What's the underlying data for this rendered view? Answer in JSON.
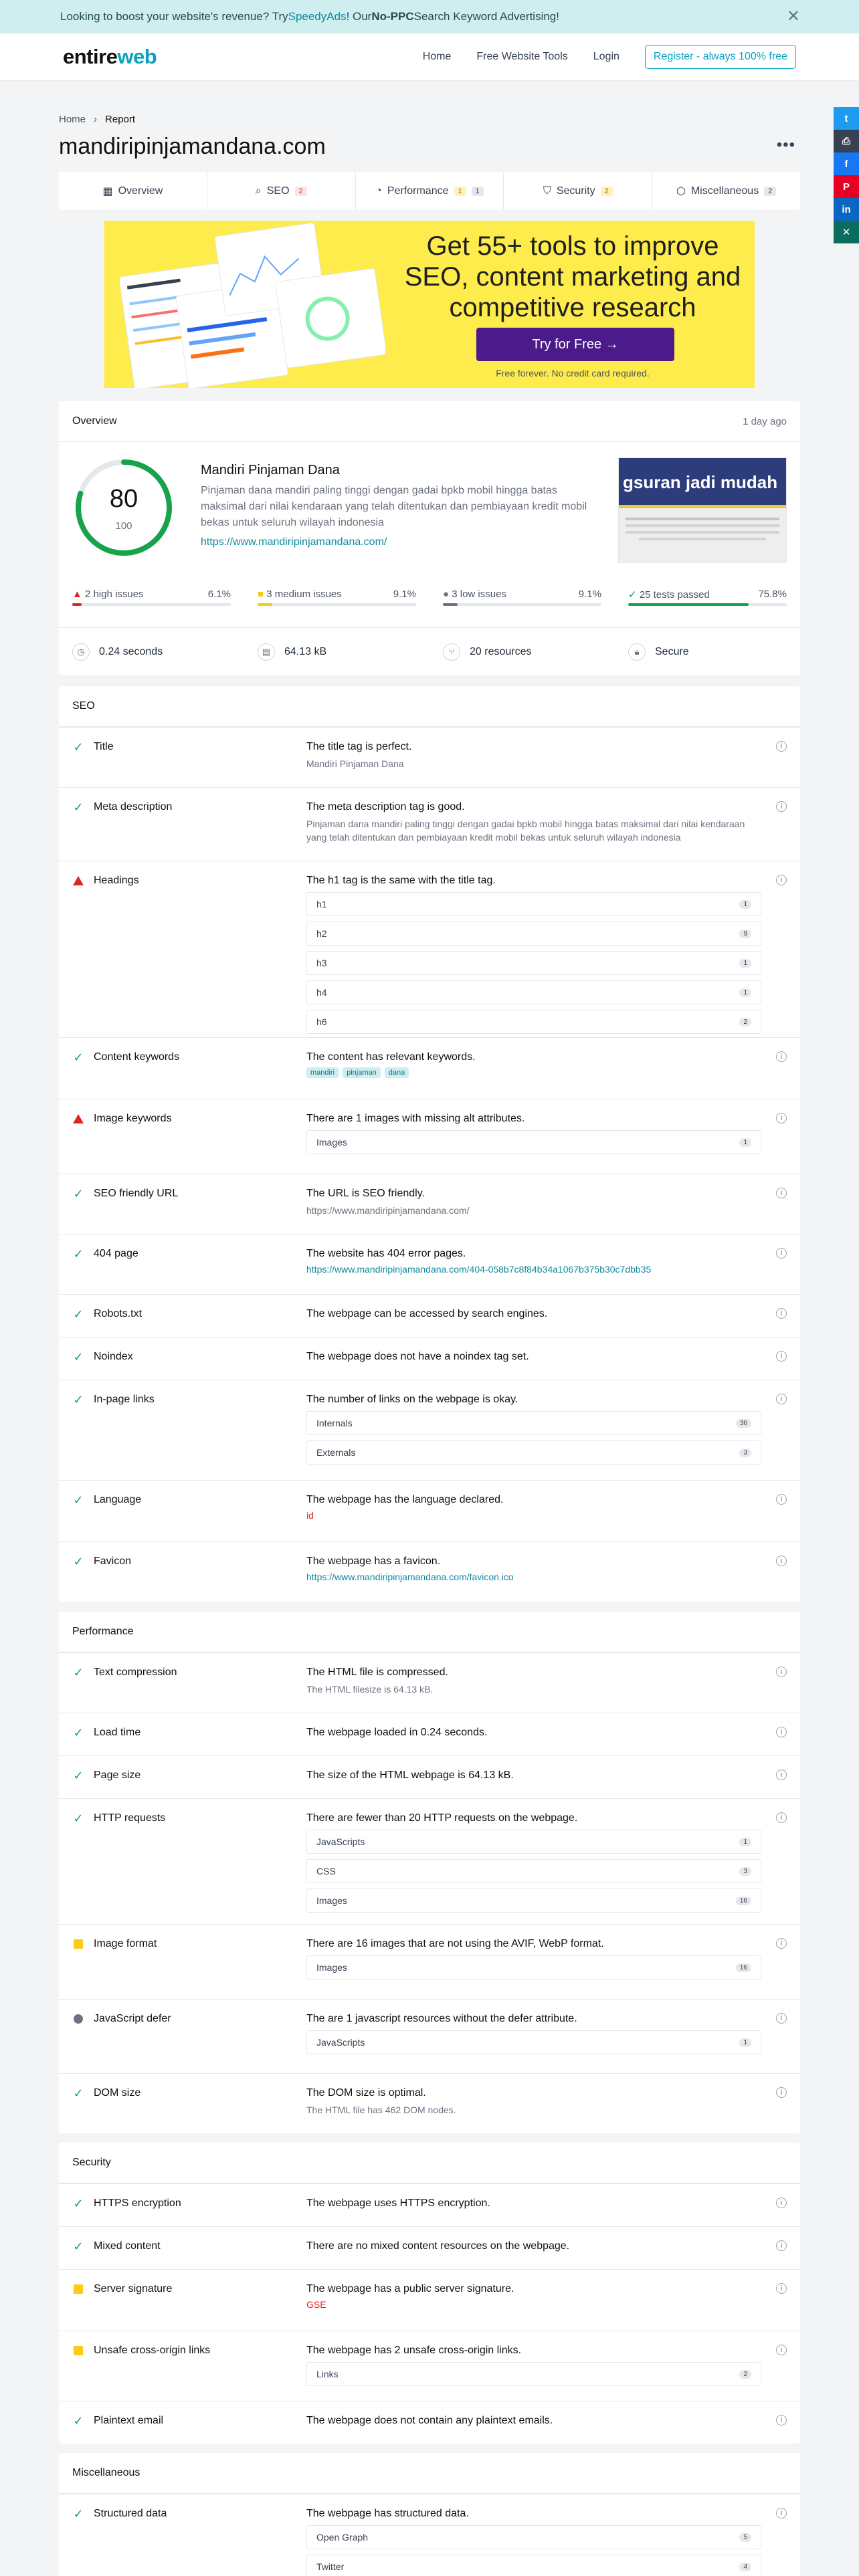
{
  "banner": {
    "pre": "Looking to boost your website's revenue? Try ",
    "brand": "SpeedyAds",
    "mid": "! Our ",
    "bold": "No-PPC",
    "post": " Search Keyword Advertising!"
  },
  "nav": {
    "logo_a": "entire",
    "logo_b": "web",
    "home": "Home",
    "tools": "Free Website Tools",
    "login": "Login",
    "register": "Register - always 100% free"
  },
  "breadcrumb": {
    "home": "Home",
    "current": "Report"
  },
  "domain": "mandiripinjamandana.com",
  "tabs": [
    {
      "label": "Overview"
    },
    {
      "label": "SEO",
      "badge": "2"
    },
    {
      "label": "Performance",
      "badge1": "1",
      "badge2": "1"
    },
    {
      "label": "Security",
      "badge": "2"
    },
    {
      "label": "Miscellaneous",
      "badge": "2"
    }
  ],
  "promo": {
    "headline": "Get 55+ tools to improve SEO, content marketing and competitive research",
    "button": "Try for Free →",
    "note": "Free forever. No credit card required."
  },
  "overview": {
    "title": "Overview",
    "time": "1 day ago",
    "score": "80",
    "score_max": "100",
    "site_name": "Mandiri Pinjaman Dana",
    "site_desc": "Pinjaman dana mandiri paling tinggi dengan gadai bpkb mobil hingga batas maksimal dari nilai kendaraan yang telah ditentukan dan pembiayaan kredit mobil bekas untuk seluruh wilayah indonesia",
    "site_url": "https://www.mandiripinjamandana.com/",
    "thumb_text": "gsuran jadi mudah",
    "stats": [
      {
        "label": "2 high issues",
        "pct": "6.1%",
        "fill": 6.1,
        "color": "#dc2626"
      },
      {
        "label": "3 medium issues",
        "pct": "9.1%",
        "fill": 9.1,
        "color": "#facc15"
      },
      {
        "label": "3 low issues",
        "pct": "9.1%",
        "fill": 9.1,
        "color": "#6b7280"
      },
      {
        "label": "25 tests passed",
        "pct": "75.8%",
        "fill": 75.8,
        "color": "#16a34a"
      }
    ],
    "info": [
      {
        "label": "0.24 seconds",
        "icon": "clock-icon"
      },
      {
        "label": "64.13 kB",
        "icon": "size-icon"
      },
      {
        "label": "20 resources",
        "icon": "resources-icon"
      },
      {
        "label": "Secure",
        "icon": "lock-icon"
      }
    ]
  },
  "seo": {
    "title": "SEO",
    "rows": {
      "title": {
        "name": "Title",
        "text": "The title tag is perfect.",
        "sub": "Mandiri Pinjaman Dana"
      },
      "meta": {
        "name": "Meta description",
        "text": "The meta description tag is good.",
        "sub": "Pinjaman dana mandiri paling tinggi dengan gadai bpkb mobil hingga batas maksimal dari nilai kendaraan yang telah ditentukan dan pembiayaan kredit mobil bekas untuk seluruh wilayah indonesia"
      },
      "headings": {
        "name": "Headings",
        "text": "The h1 tag is the same with the title tag.",
        "items": [
          {
            "k": "h1",
            "v": "1"
          },
          {
            "k": "h2",
            "v": "9"
          },
          {
            "k": "h3",
            "v": "1"
          },
          {
            "k": "h4",
            "v": "1"
          },
          {
            "k": "h6",
            "v": "2"
          }
        ]
      },
      "content": {
        "name": "Content keywords",
        "text": "The content has relevant keywords.",
        "kw": [
          "mandiri",
          "pinjaman",
          "dana"
        ]
      },
      "imgkw": {
        "name": "Image keywords",
        "text": "There are 1 images with missing alt attributes.",
        "box": "Images",
        "count": "1"
      },
      "url": {
        "name": "SEO friendly URL",
        "text": "The URL is SEO friendly.",
        "sub": "https://www.mandiripinjamandana.com/"
      },
      "p404": {
        "name": "404 page",
        "text": "The website has 404 error pages.",
        "link": "https://www.mandiripinjamandana.com/404-058b7c8f84b34a1067b375b30c7dbb35"
      },
      "robots": {
        "name": "Robots.txt",
        "text": "The webpage can be accessed by search engines."
      },
      "noindex": {
        "name": "Noindex",
        "text": "The webpage does not have a noindex tag set."
      },
      "inpage": {
        "name": "In-page links",
        "text": "The number of links on the webpage is okay.",
        "items": [
          {
            "k": "Internals",
            "v": "36"
          },
          {
            "k": "Externals",
            "v": "3"
          }
        ]
      },
      "lang": {
        "name": "Language",
        "text": "The webpage has the language declared.",
        "val": "id"
      },
      "favicon": {
        "name": "Favicon",
        "text": "The webpage has a favicon.",
        "link": "https://www.mandiripinjamandana.com/favicon.ico"
      }
    }
  },
  "perf": {
    "title": "Performance",
    "rows": {
      "comp": {
        "name": "Text compression",
        "text": "The HTML file is compressed.",
        "sub": "The HTML filesize is 64.13 kB."
      },
      "load": {
        "name": "Load time",
        "text": "The webpage loaded in 0.24 seconds."
      },
      "size": {
        "name": "Page size",
        "text": "The size of the HTML webpage is 64.13 kB."
      },
      "http": {
        "name": "HTTP requests",
        "text": "There are fewer than 20 HTTP requests on the webpage.",
        "items": [
          {
            "k": "JavaScripts",
            "v": "1"
          },
          {
            "k": "CSS",
            "v": "3"
          },
          {
            "k": "Images",
            "v": "16"
          }
        ]
      },
      "imgf": {
        "name": "Image format",
        "text": "There are 16 images that are not using the AVIF, WebP format.",
        "box": "Images",
        "count": "16"
      },
      "defer": {
        "name": "JavaScript defer",
        "text": "The are 1 javascript resources without the defer attribute.",
        "box": "JavaScripts",
        "count": "1"
      },
      "dom": {
        "name": "DOM size",
        "text": "The DOM size is optimal.",
        "sub": "The HTML file has 462 DOM nodes."
      }
    }
  },
  "sec": {
    "title": "Security",
    "rows": {
      "https": {
        "name": "HTTPS encryption",
        "text": "The webpage uses HTTPS encryption."
      },
      "mixed": {
        "name": "Mixed content",
        "text": "There are no mixed content resources on the webpage."
      },
      "server": {
        "name": "Server signature",
        "text": "The webpage has a public server signature.",
        "val": "GSE"
      },
      "unsafe": {
        "name": "Unsafe cross-origin links",
        "text": "The webpage has 2 unsafe cross-origin links.",
        "box": "Links",
        "count": "2"
      },
      "email": {
        "name": "Plaintext email",
        "text": "The webpage does not contain any plaintext emails."
      }
    }
  },
  "misc": {
    "title": "Miscellaneous",
    "rows": {
      "struct": {
        "name": "Structured data",
        "text": "The webpage has structured data.",
        "items": [
          {
            "k": "Open Graph",
            "v": "5"
          },
          {
            "k": "Twitter",
            "v": "4"
          }
        ]
      }
    }
  },
  "colors": {
    "accent": "#0aa3bf",
    "promo": "#fdec4b",
    "button": "#4b1c89",
    "pass": "#16a34a",
    "high": "#dc2626",
    "medium": "#facc15",
    "low": "#6b7280"
  }
}
